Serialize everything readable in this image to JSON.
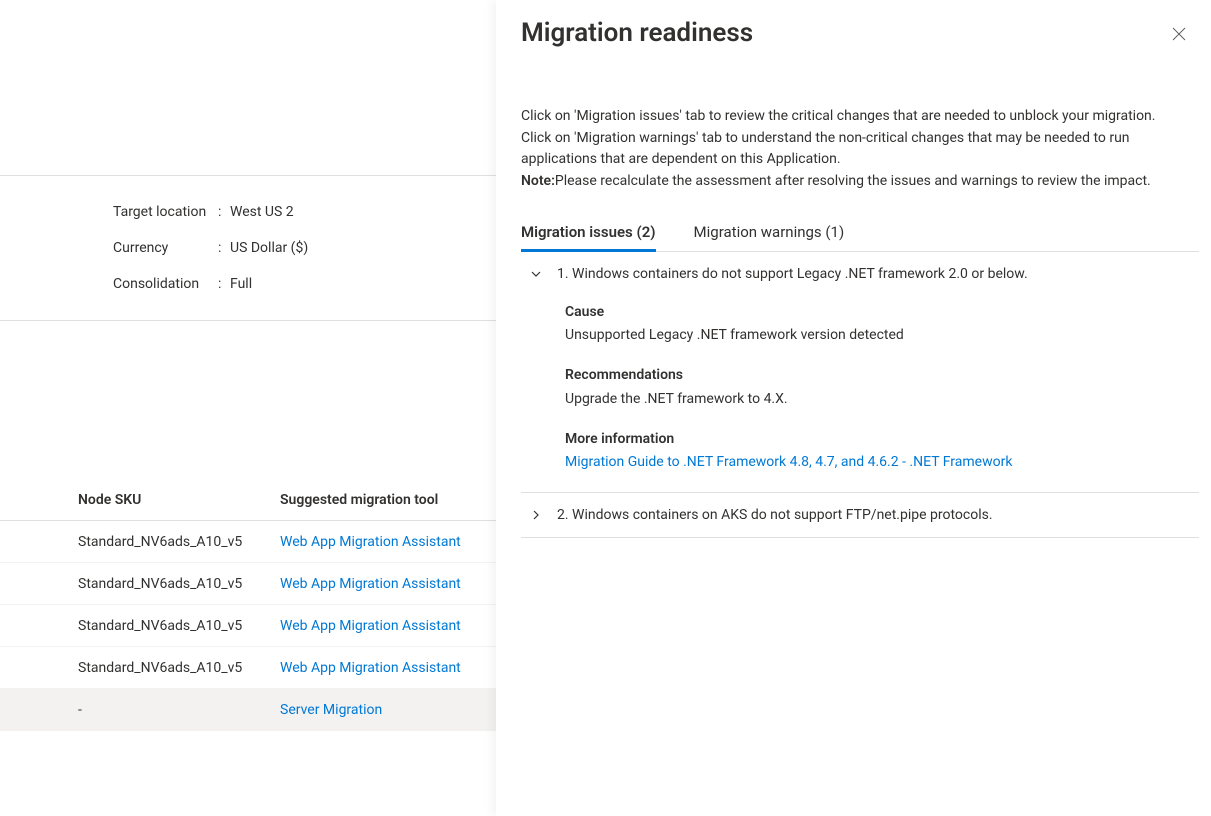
{
  "kv": {
    "target_location_label": "Target location",
    "target_location_value": "West US 2",
    "currency_label": "Currency",
    "currency_value": "US Dollar ($)",
    "consolidation_label": "Consolidation",
    "consolidation_value": "Full"
  },
  "table": {
    "headers": {
      "sku": "Node SKU",
      "tool": "Suggested migration tool"
    },
    "rows": [
      {
        "sku": "Standard_NV6ads_A10_v5",
        "tool": "Web App Migration Assistant"
      },
      {
        "sku": "Standard_NV6ads_A10_v5",
        "tool": "Web App Migration Assistant"
      },
      {
        "sku": "Standard_NV6ads_A10_v5",
        "tool": "Web App Migration Assistant"
      },
      {
        "sku": "Standard_NV6ads_A10_v5",
        "tool": "Web App Migration Assistant"
      },
      {
        "sku": "-",
        "tool": "Server Migration"
      }
    ]
  },
  "panel": {
    "title": "Migration readiness",
    "desc_main": "Click on 'Migration issues' tab to review the critical changes that are needed to unblock your migration. Click on 'Migration warnings' tab to understand the non-critical changes that may be needed to run applications that are dependent on this Application.",
    "note_label": "Note:",
    "note_text": "Please recalculate the assessment after resolving the issues and warnings to review the impact.",
    "tabs": {
      "issues": "Migration issues (2)",
      "warnings": "Migration warnings (1)"
    },
    "issues": [
      {
        "title": "1. Windows containers do not support Legacy .NET framework 2.0 or below.",
        "expanded": true,
        "cause_label": "Cause",
        "cause_text": "Unsupported Legacy .NET framework version detected",
        "rec_label": "Recommendations",
        "rec_text": "Upgrade the .NET framework to 4.X.",
        "more_label": "More information",
        "more_link": "Migration Guide to .NET Framework 4.8, 4.7, and 4.6.2 - .NET Framework"
      },
      {
        "title": "2. Windows containers on AKS do not support FTP/net.pipe protocols.",
        "expanded": false
      }
    ]
  }
}
